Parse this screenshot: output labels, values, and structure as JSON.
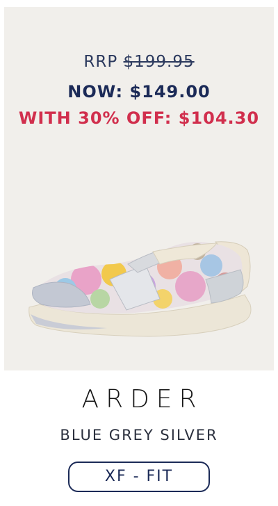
{
  "pricing": {
    "rrp_label": "RRP",
    "rrp_price": "$199.95",
    "now_text": "NOW: $149.00",
    "discount_text": "WITH 30% OFF: $104.30"
  },
  "product": {
    "name": "ARDER",
    "color": "BLUE GREY SILVER",
    "image_icon": "shoe-image"
  },
  "fit_badge": {
    "label": "XF - FIT"
  },
  "colors": {
    "card_background": "#f1efeb",
    "navy": "#1b2a57",
    "discount_red": "#d12f4d"
  }
}
